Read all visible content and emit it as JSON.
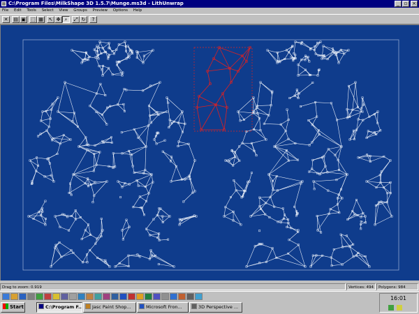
{
  "window": {
    "title": "C:\\Program Files\\MilkShape 3D 1.5.7\\Munge.ms3d - LithUnwrap"
  },
  "menu": [
    "File",
    "Edit",
    "Tools",
    "Select",
    "View",
    "Groups",
    "Preview",
    "Options",
    "Help"
  ],
  "toolbar": [
    {
      "icon": "close-file-icon",
      "glyph": "✕"
    },
    {
      "icon": "open-folder-icon",
      "glyph": "▤"
    },
    {
      "icon": "save-icon",
      "glyph": "▣"
    },
    {
      "icon": "select-icon",
      "glyph": "⬚"
    },
    {
      "icon": "group-icon",
      "glyph": "▦"
    },
    {
      "icon": "pointer-icon",
      "glyph": "↖"
    },
    {
      "icon": "move-icon",
      "glyph": "✥"
    },
    {
      "icon": "zoom-icon",
      "glyph": "⌕"
    },
    {
      "icon": "fit-view-icon",
      "glyph": "⤢"
    },
    {
      "icon": "rotate-icon",
      "glyph": "↻"
    },
    {
      "icon": "help-icon",
      "glyph": "?"
    }
  ],
  "status": {
    "hint": "Drag to zoom: 0.919",
    "vertices": "Vertices: 494",
    "polygons": "Polygons: 984"
  },
  "taskbar": {
    "start_label": "Start",
    "tasks": [
      {
        "label": "C:\\Program F...",
        "active": true,
        "color": "#000080"
      },
      {
        "label": "Jasc Paint Shop...",
        "active": false,
        "color": "#c08020"
      },
      {
        "label": "Microsoft Fron...",
        "active": false,
        "color": "#2050c0"
      },
      {
        "label": "3D Perspective ...",
        "active": false,
        "color": "#606060"
      }
    ],
    "clock": "16:01"
  },
  "colors": {
    "canvas": "#0f3c8c",
    "mesh": "#e8eef8",
    "selection": "#e02020"
  }
}
